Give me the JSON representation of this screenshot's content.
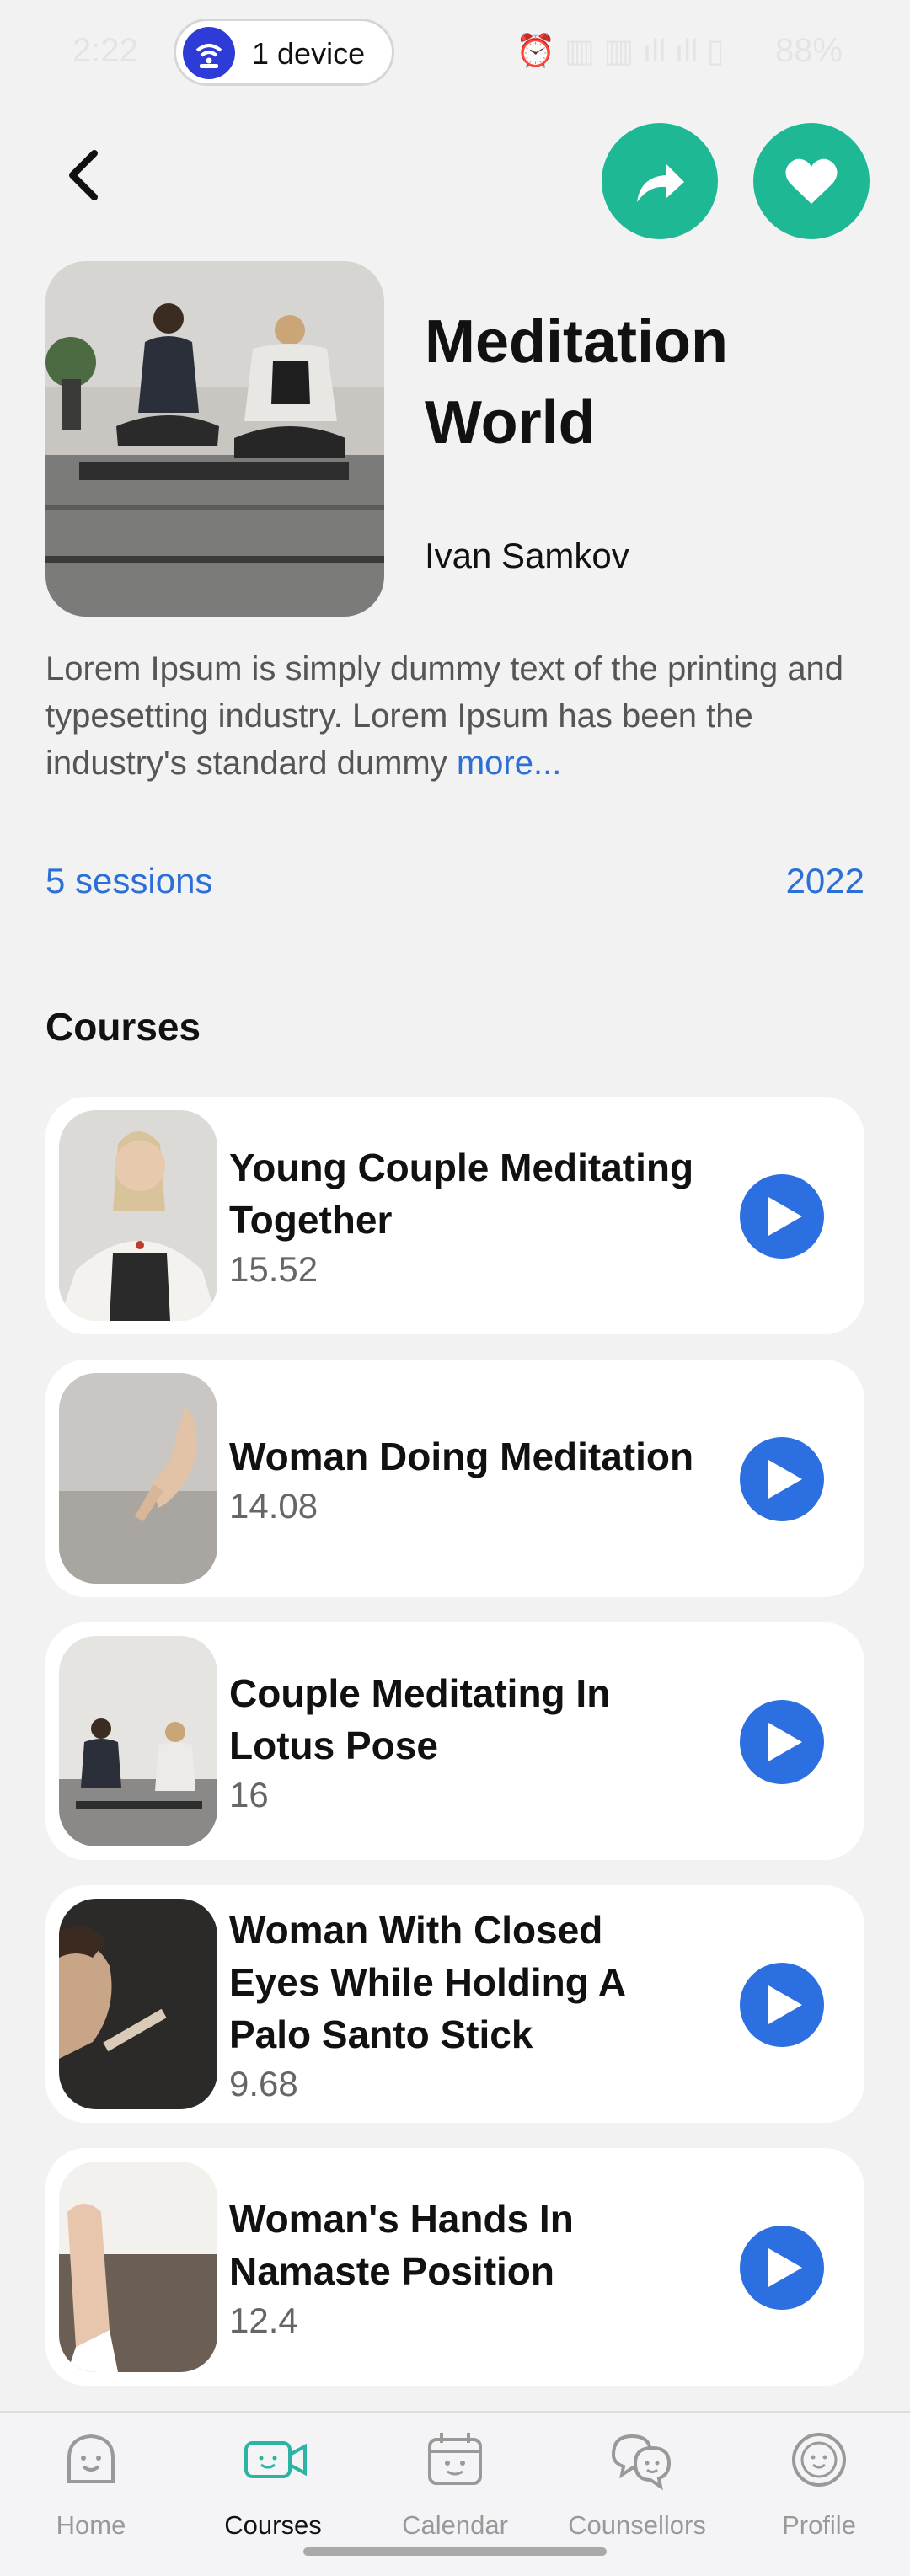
{
  "status_bar": {
    "time": "2:22",
    "device_label": "1 device",
    "icons_text": "⏰ ▥ ▥  ıll ıll ▯",
    "battery": "88%"
  },
  "header": {
    "back_icon": "chevron-left-icon",
    "share_icon": "share-icon",
    "favorite_icon": "heart-icon"
  },
  "album": {
    "title": "Meditation World",
    "author": "Ivan Samkov",
    "description": "Lorem Ipsum is simply dummy text of the printing and typesetting industry. Lorem Ipsum has been the industry's standard dummy more...",
    "more_label": "more...",
    "sessions": "5 sessions",
    "year": "2022"
  },
  "section_title": "Courses",
  "courses": [
    {
      "title": "Young Couple Meditating Together",
      "duration": "15.52"
    },
    {
      "title": "Woman Doing Meditation",
      "duration": "14.08"
    },
    {
      "title": "Couple Meditating In Lotus Pose",
      "duration": "16"
    },
    {
      "title": "Woman With Closed Eyes While Holding A Palo Santo Stick",
      "duration": "9.68"
    },
    {
      "title": "Woman's Hands In Namaste Position",
      "duration": "12.4"
    }
  ],
  "nav": [
    {
      "label": "Home",
      "icon": "home-face-icon",
      "active": false
    },
    {
      "label": "Courses",
      "icon": "video-camera-icon",
      "active": true
    },
    {
      "label": "Calendar",
      "icon": "calendar-icon",
      "active": false
    },
    {
      "label": "Counsellors",
      "icon": "chat-bubbles-icon",
      "active": false
    },
    {
      "label": "Profile",
      "icon": "profile-face-icon",
      "active": false
    }
  ],
  "colors": {
    "accent_green": "#1fb894",
    "link_blue": "#2c6fd6",
    "play_blue": "#2c6fe0",
    "nav_active": "#2bb3a3"
  }
}
